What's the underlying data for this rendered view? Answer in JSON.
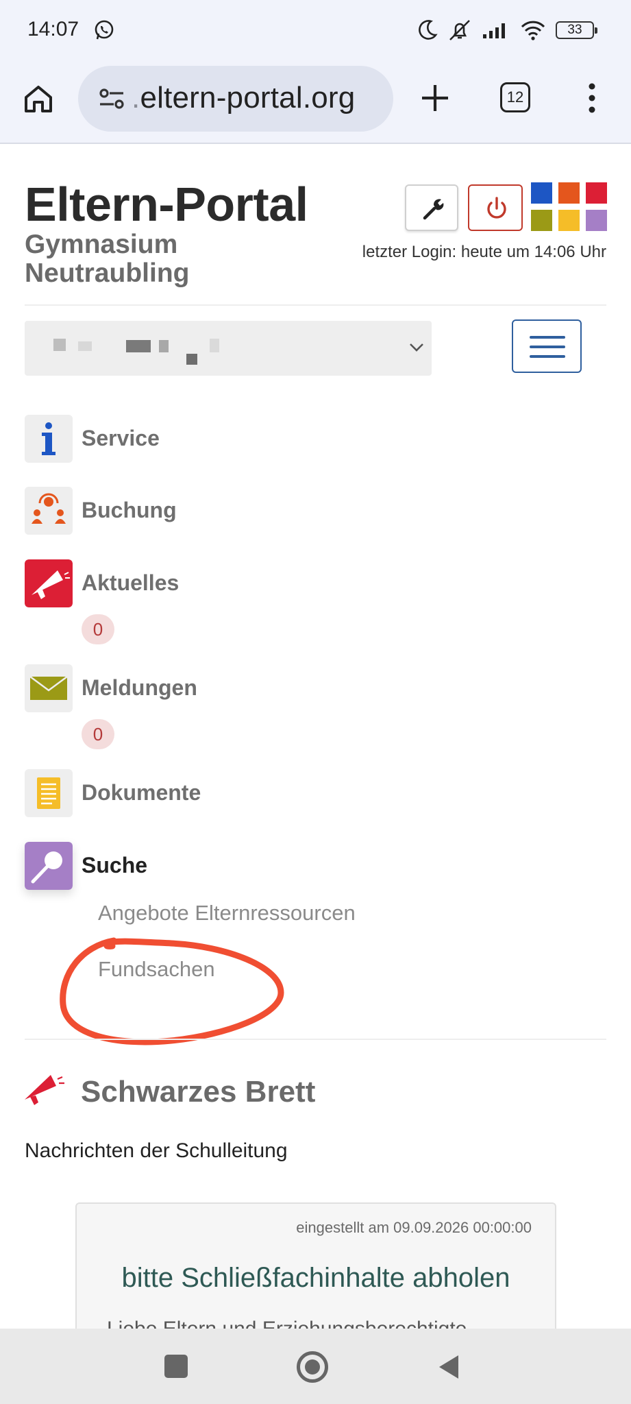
{
  "status_bar": {
    "time": "14:07",
    "battery": "33"
  },
  "browser": {
    "url_prefix": ".",
    "url_main": "eltern-portal.org",
    "tab_count": "12"
  },
  "header": {
    "title": "Eltern-Portal",
    "school": "Gymnasium Neutraubling",
    "last_login": "letzter Login: heute um 14:06 Uhr",
    "theme_colors": [
      "#1d56c4",
      "#e4561d",
      "#dc1f35",
      "#9b9a16",
      "#f5bd28",
      "#a57fc6"
    ]
  },
  "nav": {
    "items": [
      {
        "label": "Service",
        "icon": "info-icon"
      },
      {
        "label": "Buchung",
        "icon": "people-icon"
      },
      {
        "label": "Aktuelles",
        "icon": "megaphone-icon",
        "badge": "0"
      },
      {
        "label": "Meldungen",
        "icon": "envelope-icon",
        "badge": "0"
      },
      {
        "label": "Dokumente",
        "icon": "document-icon"
      },
      {
        "label": "Suche",
        "icon": "magnifier-icon"
      }
    ],
    "sub_items": [
      "Angebote Elternressourcen",
      "Fundsachen"
    ]
  },
  "board": {
    "title": "Schwarzes Brett",
    "subtitle": "Nachrichten der Schulleitung",
    "card": {
      "date": "eingestellt am 09.09.2026 00:00:00",
      "title": "bitte Schließfachinhalte abholen",
      "snippet": "Liebe Eltern und Erziehungsberechtigte,"
    }
  }
}
